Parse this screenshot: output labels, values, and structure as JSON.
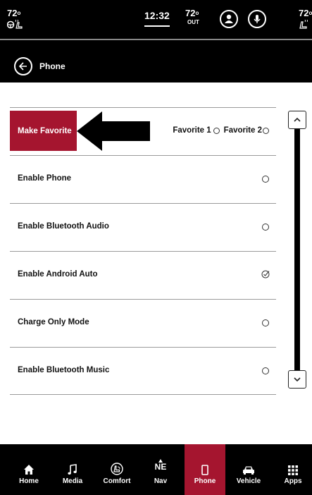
{
  "status_bar": {
    "driver_temp": "72",
    "clock": "12:32",
    "outside_temp": "72",
    "outside_label": "OUT",
    "passenger_temp": "72",
    "degree": "o"
  },
  "title_bar": {
    "title": "Phone"
  },
  "favorite_row": {
    "button_label": "Make Favorite",
    "options": [
      "Favorite 1",
      "Favorite 2"
    ]
  },
  "settings": [
    {
      "label": "Enable Phone",
      "checked": false
    },
    {
      "label": "Enable Bluetooth Audio",
      "checked": false
    },
    {
      "label": "Enable Android Auto",
      "checked": true
    },
    {
      "label": "Charge Only Mode",
      "checked": false
    },
    {
      "label": "Enable Bluetooth Music",
      "checked": false
    }
  ],
  "bottom_nav": {
    "items": [
      {
        "label": "Home",
        "icon": "home-icon"
      },
      {
        "label": "Media",
        "icon": "music-note-icon"
      },
      {
        "label": "Comfort",
        "icon": "seat-comfort-icon"
      },
      {
        "label": "Nav",
        "icon": "compass-icon",
        "heading": "NE"
      },
      {
        "label": "Phone",
        "icon": "phone-icon",
        "active": true
      },
      {
        "label": "Vehicle",
        "icon": "car-icon"
      },
      {
        "label": "Apps",
        "icon": "apps-grid-icon"
      }
    ]
  },
  "colors": {
    "accent": "#a5152f",
    "bar_background": "#000000"
  }
}
